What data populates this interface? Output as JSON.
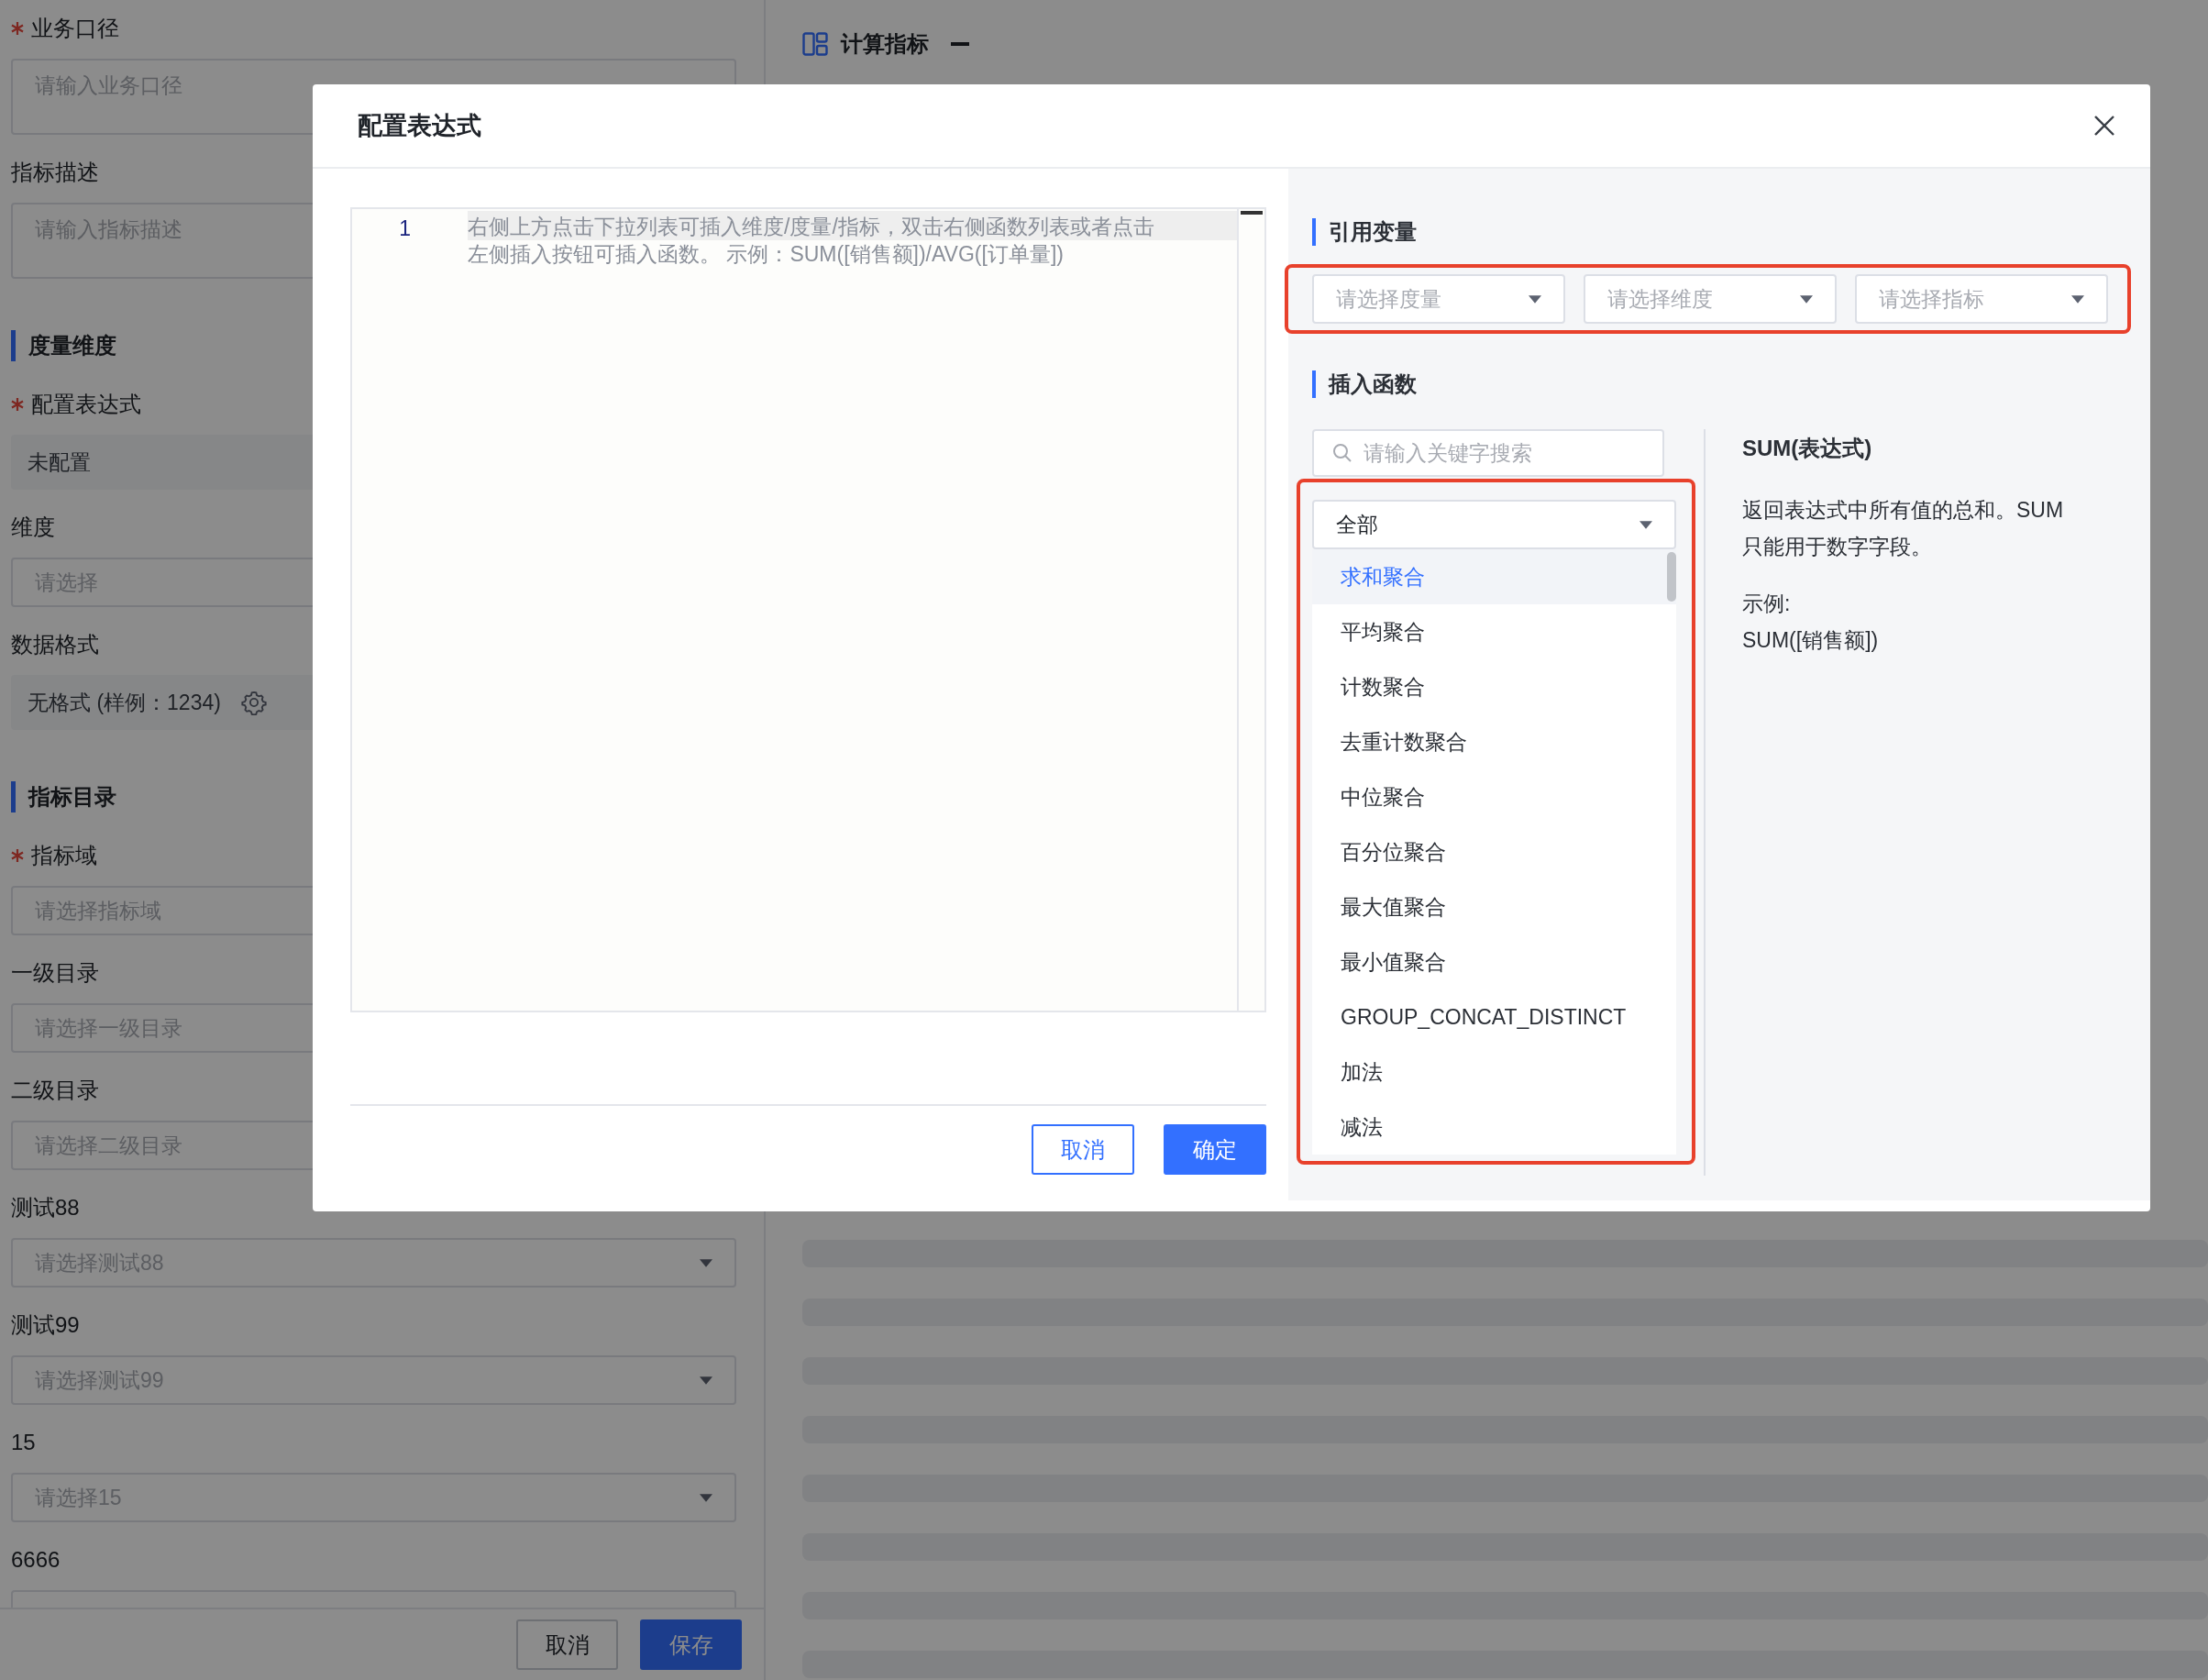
{
  "page_form": {
    "items": [
      {
        "kind": "textarea",
        "label": "业务口径",
        "required": true,
        "placeholder": "请输入业务口径"
      },
      {
        "kind": "textarea",
        "label": "指标描述",
        "required": false,
        "placeholder": "请输入指标描述"
      },
      {
        "kind": "section",
        "label": "度量维度"
      },
      {
        "kind": "static",
        "label": "配置表达式",
        "required": true,
        "value": "未配置"
      },
      {
        "kind": "input",
        "label": "维度",
        "required": false,
        "placeholder": "请选择"
      },
      {
        "kind": "format",
        "label": "数据格式",
        "required": false,
        "value": "无格式 (样例：1234)"
      },
      {
        "kind": "section",
        "label": "指标目录"
      },
      {
        "kind": "input",
        "label": "指标域",
        "required": true,
        "placeholder": "请选择指标域"
      },
      {
        "kind": "input",
        "label": "一级目录",
        "required": false,
        "placeholder": "请选择一级目录"
      },
      {
        "kind": "input",
        "label": "二级目录",
        "required": false,
        "placeholder": "请选择二级目录"
      },
      {
        "kind": "select",
        "label": "测试88",
        "required": false,
        "placeholder": "请选择测试88"
      },
      {
        "kind": "select",
        "label": "测试99",
        "required": false,
        "placeholder": "请选择测试99"
      },
      {
        "kind": "select",
        "label": "15",
        "required": false,
        "placeholder": "请选择15"
      },
      {
        "kind": "select",
        "label": "6666",
        "required": false
      }
    ],
    "footer_buttons": [
      {
        "label": "取消",
        "kind": "secondary"
      },
      {
        "label": "保存",
        "kind": "primary"
      }
    ]
  },
  "page_header": {
    "title": "计算指标"
  },
  "dialog": {
    "title": "配置表达式",
    "editor": {
      "line_numbers": [
        "1"
      ],
      "placeholder": "右侧上方点击下拉列表可插入维度/度量/指标，双击右侧函数列表或者点击左侧插入按钮可插入函数。 示例：SUM([销售额])/AVG([订单量])"
    },
    "buttons": [
      {
        "label": "取消",
        "kind": "secondary"
      },
      {
        "label": "确定",
        "kind": "primary"
      }
    ],
    "variables": {
      "title": "引用变量",
      "highlighted": true,
      "selects": [
        {
          "placeholder": "请选择度量"
        },
        {
          "placeholder": "请选择维度"
        },
        {
          "placeholder": "请选择指标"
        }
      ]
    },
    "functions": {
      "title": "插入函数",
      "search": {
        "placeholder": "请输入关键字搜索"
      },
      "highlighted": true,
      "category": {
        "value": "全部"
      },
      "items": [
        {
          "label": "求和聚合",
          "selected": true
        },
        {
          "label": "平均聚合",
          "selected": false
        },
        {
          "label": "计数聚合",
          "selected": false
        },
        {
          "label": "去重计数聚合",
          "selected": false
        },
        {
          "label": "中位聚合",
          "selected": false
        },
        {
          "label": "百分位聚合",
          "selected": false
        },
        {
          "label": "最大值聚合",
          "selected": false
        },
        {
          "label": "最小值聚合",
          "selected": false
        },
        {
          "label": "GROUP_CONCAT_DISTINCT",
          "selected": false
        },
        {
          "label": "加法",
          "selected": false
        },
        {
          "label": "减法",
          "selected": false
        }
      ]
    },
    "detail": {
      "title": "SUM(表达式)",
      "description": "返回表达式中所有值的总和。SUM只能用于数字字段。",
      "example_label": "示例:",
      "example": "SUM([销售额])"
    }
  }
}
